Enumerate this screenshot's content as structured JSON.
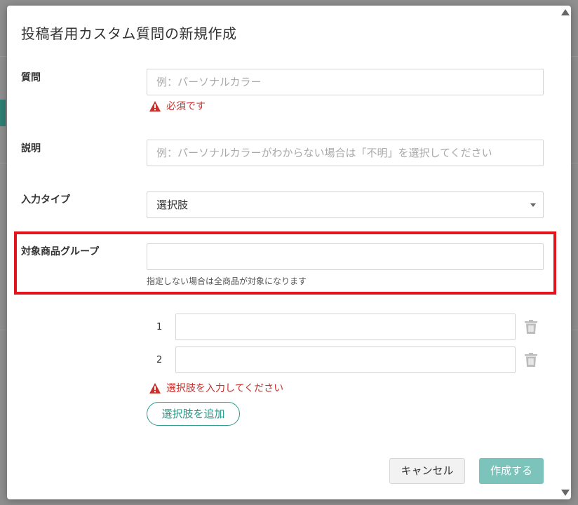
{
  "modal": {
    "title": "投稿者用カスタム質問の新規作成"
  },
  "form": {
    "question": {
      "label": "質問",
      "placeholder": "例：パーソナルカラー",
      "error": "必須です"
    },
    "description": {
      "label": "説明",
      "placeholder": "例：パーソナルカラーがわからない場合は「不明」を選択してください"
    },
    "input_type": {
      "label": "入力タイプ",
      "value": "選択肢"
    },
    "target_group": {
      "label": "対象商品グループ",
      "value": "",
      "hint": "指定しない場合は全商品が対象になります"
    },
    "choices": [
      {
        "number": "1",
        "value": ""
      },
      {
        "number": "2",
        "value": ""
      }
    ],
    "choices_error": "選択肢を入力してください",
    "add_choice_label": "選択肢を追加"
  },
  "footer": {
    "cancel_label": "キャンセル",
    "create_label": "作成する"
  },
  "colors": {
    "accent": "#2a9a8a",
    "error": "#c9302c",
    "highlight": "#e3141d",
    "primary_disabled": "#7cc4bb"
  }
}
